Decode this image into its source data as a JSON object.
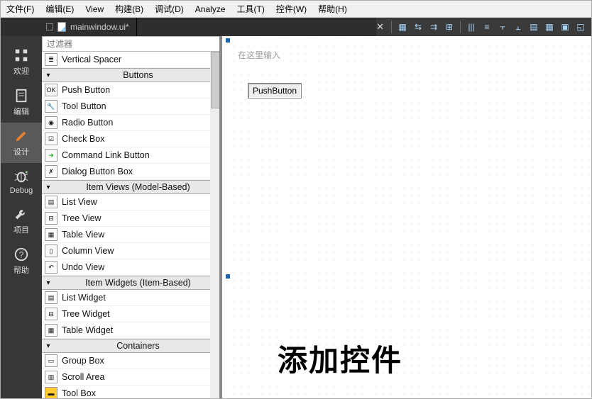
{
  "menu": {
    "file": "文件(F)",
    "edit": "编辑(E)",
    "view": "View",
    "build": "构建(B)",
    "debug": "调试(D)",
    "analyze": "Analyze",
    "tools": "工具(T)",
    "widgets": "控件(W)",
    "help": "帮助(H)"
  },
  "tab": {
    "filename": "mainwindow.ui*"
  },
  "sidebar": {
    "welcome": "欢迎",
    "edit": "编辑",
    "design": "设计",
    "debug": "Debug",
    "project": "项目",
    "help": "帮助"
  },
  "filter_placeholder": "过滤器",
  "groups": {
    "spacer_item": "Vertical Spacer",
    "buttons": "Buttons",
    "itemviews": "Item Views (Model-Based)",
    "itemwidgets": "Item Widgets (Item-Based)",
    "containers": "Containers"
  },
  "widgets": {
    "push_button": "Push Button",
    "tool_button": "Tool Button",
    "radio_button": "Radio Button",
    "check_box": "Check Box",
    "command_link": "Command Link Button",
    "dialog_box": "Dialog Button Box",
    "list_view": "List View",
    "tree_view": "Tree View",
    "table_view": "Table View",
    "column_view": "Column View",
    "undo_view": "Undo View",
    "list_widget": "List Widget",
    "tree_widget": "Tree Widget",
    "table_widget": "Table Widget",
    "group_box": "Group Box",
    "scroll_area": "Scroll Area",
    "tool_box": "Tool Box"
  },
  "canvas": {
    "placeholder": "在这里输入",
    "button_text": "PushButton",
    "overlay": "添加控件"
  }
}
